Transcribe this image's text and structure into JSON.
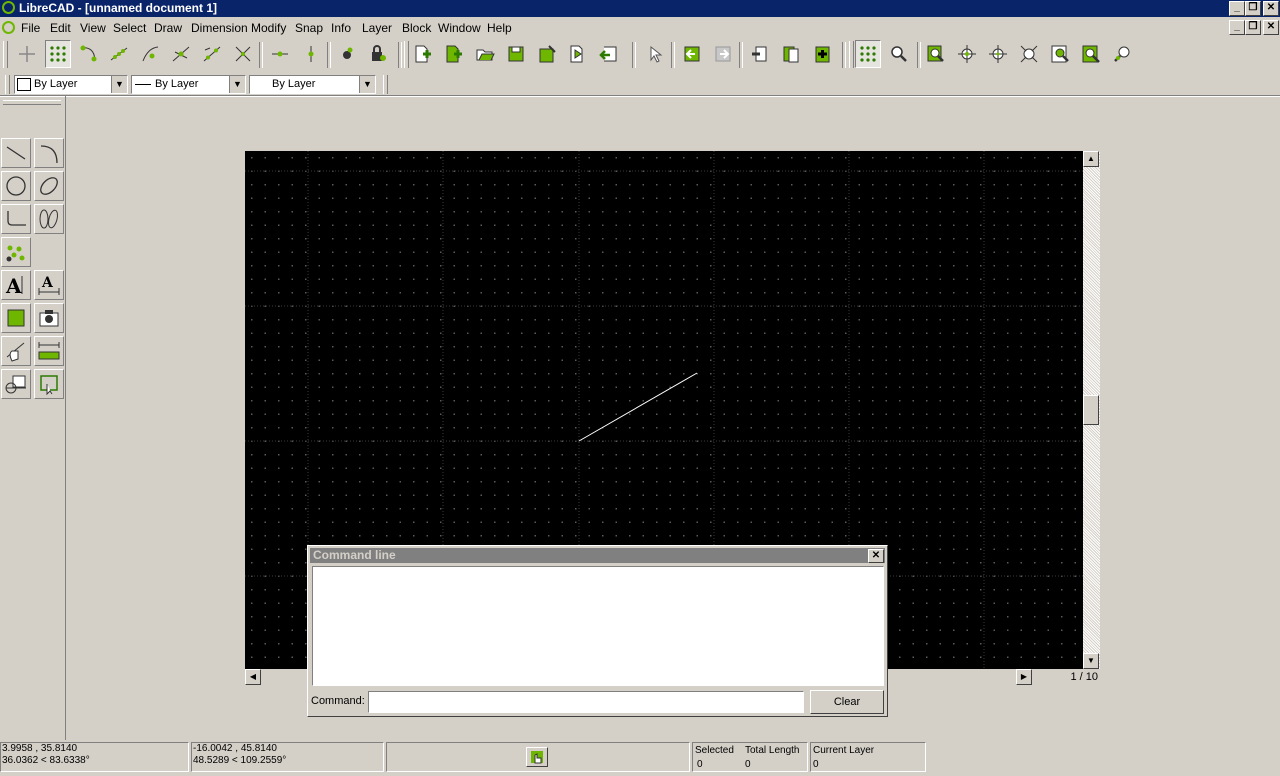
{
  "window": {
    "title": "LibreCAD - [unnamed document 1]"
  },
  "menu": [
    "File",
    "Edit",
    "View",
    "Select",
    "Draw",
    "Dimension",
    "Modify",
    "Snap",
    "Info",
    "Layer",
    "Block",
    "Window",
    "Help"
  ],
  "pen": {
    "color": "By Layer",
    "line_type": "By Layer",
    "width": "By Layer"
  },
  "scroll": {
    "page": "1 / 10"
  },
  "command": {
    "title": "Command line",
    "label": "Command:",
    "value": "",
    "clear_label": "Clear"
  },
  "status": {
    "abs_coords": "3.9958 , 35.8140",
    "abs_polar": "36.0362 < 83.6338°",
    "rel_coords": "-16.0042 , 45.8140",
    "rel_polar": "48.5289 < 109.2559°",
    "selected_label": "Selected",
    "selected_value": "0",
    "total_length_label": "Total Length",
    "total_length_value": "0",
    "current_layer_label": "Current Layer",
    "current_layer_value": "0"
  },
  "colors": {
    "title_bar": "#0a246a",
    "canvas": "#000000",
    "accent_green": "#6fb600"
  }
}
